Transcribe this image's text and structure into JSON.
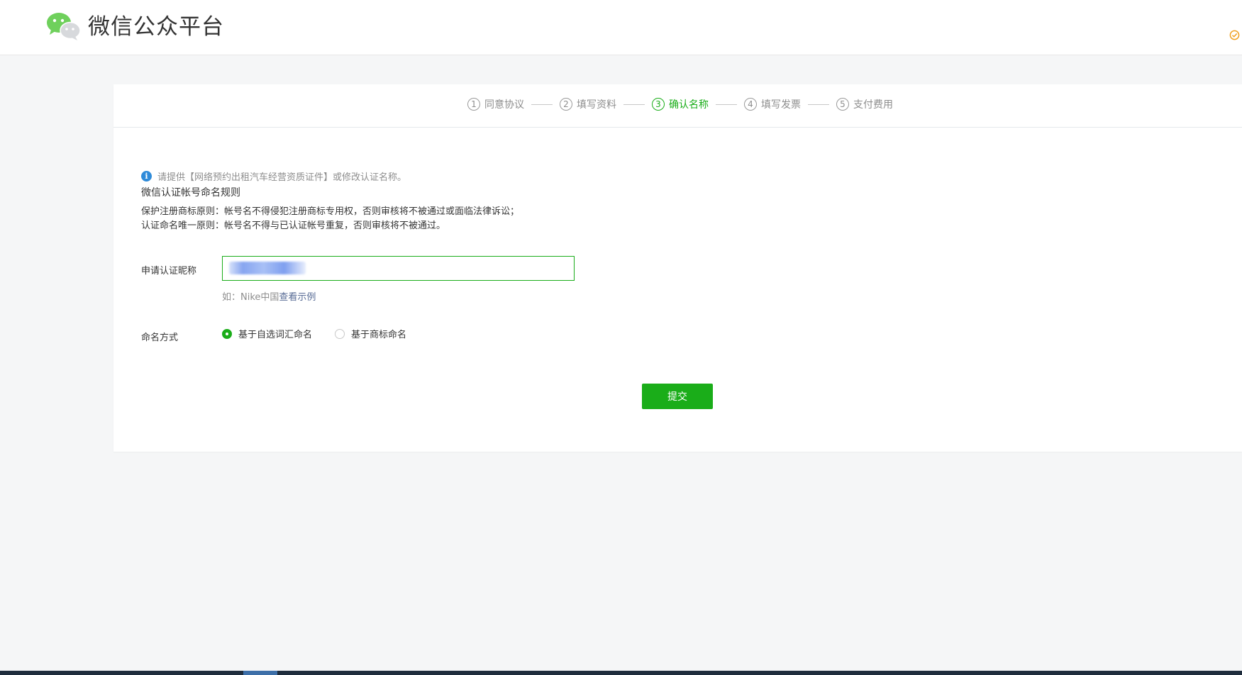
{
  "header": {
    "brand_title": "微信公众平台",
    "logo_icon": "wechat-logo-icon",
    "status_icon": "check-circle-icon"
  },
  "steps": [
    {
      "number": "1",
      "label": "同意协议",
      "active": false
    },
    {
      "number": "2",
      "label": "填写资料",
      "active": false
    },
    {
      "number": "3",
      "label": "确认名称",
      "active": true
    },
    {
      "number": "4",
      "label": "填写发票",
      "active": false
    },
    {
      "number": "5",
      "label": "支付费用",
      "active": false
    }
  ],
  "notice": {
    "icon": "info-icon",
    "text": "请提供【网络预约出租汽车经营资质证件】或修改认证名称。"
  },
  "rules": {
    "title": "微信认证帐号命名规则",
    "lines": [
      "保护注册商标原则：帐号名不得侵犯注册商标专用权，否则审核将不被通过或面临法律诉讼；",
      "认证命名唯一原则：帐号名不得与已认证帐号重复，否则审核将不被通过。"
    ]
  },
  "form": {
    "nickname_label": "申请认证昵称",
    "nickname_value": "",
    "hint_prefix": "如：Nike中国",
    "hint_link": "查看示例",
    "naming_label": "命名方式",
    "naming_options": [
      {
        "label": "基于自选词汇命名",
        "checked": true
      },
      {
        "label": "基于商标命名",
        "checked": false
      }
    ],
    "submit_label": "提交"
  },
  "colors": {
    "accent_green": "#1aad19",
    "link_blue": "#576b95",
    "info_blue": "#2f8bd9",
    "page_bg": "#f5f6f7"
  }
}
